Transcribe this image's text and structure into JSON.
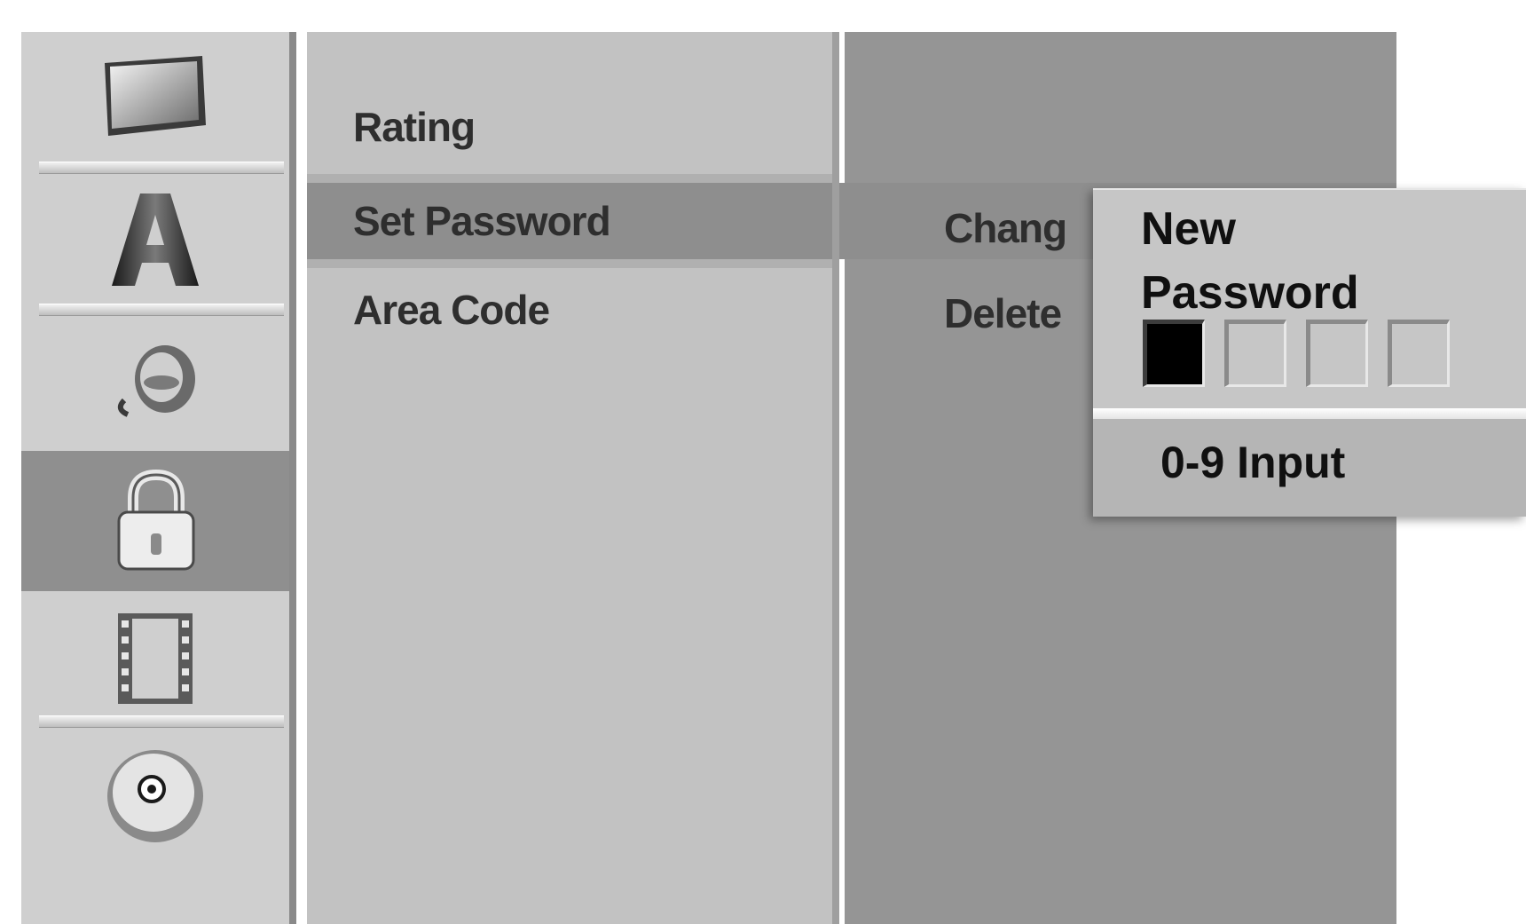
{
  "menu": {
    "items": [
      {
        "label": "Rating"
      },
      {
        "label": "Set Password"
      },
      {
        "label": "Area Code"
      }
    ]
  },
  "options": {
    "items": [
      {
        "label": "Chang"
      },
      {
        "label": "Delete"
      }
    ]
  },
  "popup": {
    "title": "New Password",
    "entered_digits": 1,
    "total_digits": 4,
    "hint": "0-9 Input"
  },
  "icons": [
    "tv-icon",
    "language-icon",
    "audio-icon",
    "lock-icon",
    "film-icon",
    "disc-icon"
  ],
  "active_icon": "lock-icon",
  "colors": {
    "highlight": "#8e8e8e",
    "panel": "#959595",
    "menu_bg": "#c2c2c2"
  }
}
